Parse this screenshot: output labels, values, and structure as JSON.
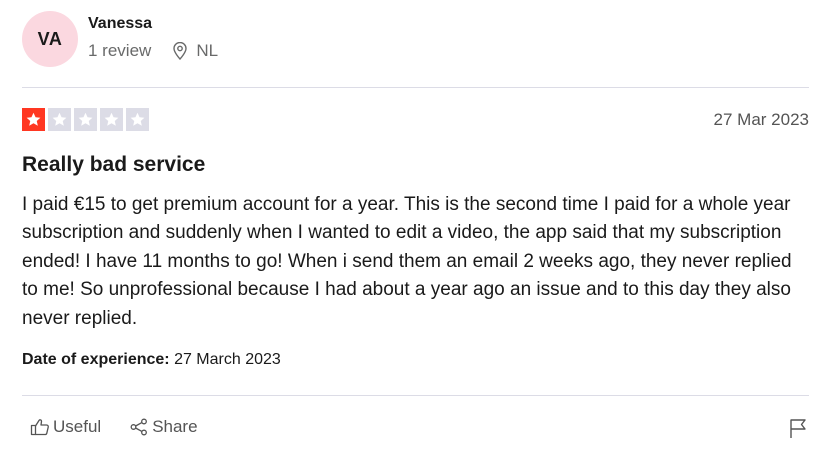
{
  "reviewer": {
    "initials": "VA",
    "name": "Vanessa",
    "review_count": "1 review",
    "country": "NL"
  },
  "review": {
    "rating": 1,
    "max_rating": 5,
    "date": "27 Mar 2023",
    "title": "Really bad service",
    "body": "I paid €15 to get premium account for a year. This is the second time I paid for a whole year subscription and suddenly when I wanted to edit a video, the app said that my subscription ended! I have 11 months to go! When i send them an email 2 weeks ago, they never replied to me! So unprofessional because I had about a year ago an issue and to this day they also never replied.",
    "experience_label": "Date of experience:",
    "experience_date": "27 March 2023"
  },
  "actions": {
    "useful_label": "Useful",
    "share_label": "Share"
  },
  "colors": {
    "star_filled": "#ff3722",
    "star_empty": "#dcdce6",
    "avatar_bg": "#fbd8e0"
  }
}
